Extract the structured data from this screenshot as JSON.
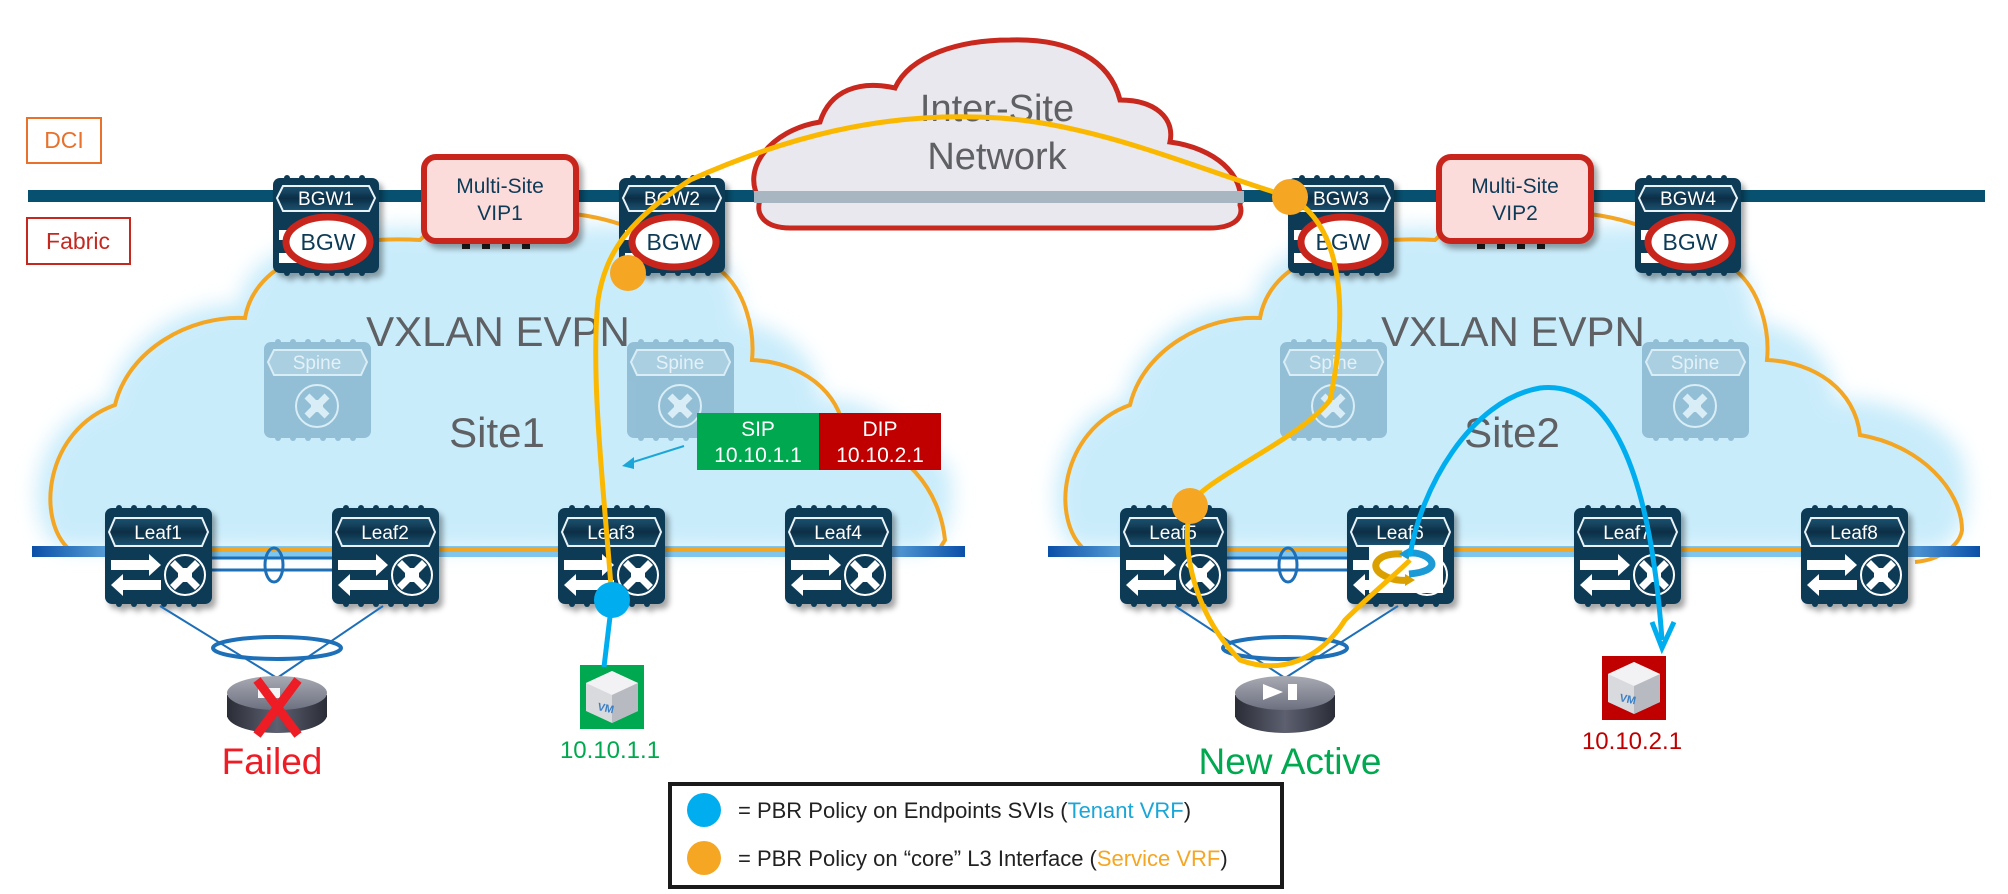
{
  "zones": {
    "dci_label": "DCI",
    "fabric_label": "Fabric"
  },
  "inter_site": {
    "line1": "Inter-Site",
    "line2": "Network"
  },
  "site1": {
    "fabric_name": "VXLAN EVPN",
    "site_name": "Site1",
    "bgws": [
      {
        "label": "BGW1",
        "badge": "BGW"
      },
      {
        "label": "BGW2",
        "badge": "BGW"
      }
    ],
    "vip": {
      "line1": "Multi-Site",
      "line2": "VIP1"
    },
    "spines": [
      {
        "label": "Spine"
      },
      {
        "label": "Spine"
      }
    ],
    "leaves": [
      {
        "label": "Leaf1"
      },
      {
        "label": "Leaf2"
      },
      {
        "label": "Leaf3"
      },
      {
        "label": "Leaf4"
      }
    ],
    "service_node_status": "Failed",
    "endpoint": {
      "ip": "10.10.1.1",
      "icon": "vm-icon",
      "color": "#00a94f"
    }
  },
  "site2": {
    "fabric_name": "VXLAN EVPN",
    "site_name": "Site2",
    "bgws": [
      {
        "label": "BGW3",
        "badge": "BGW"
      },
      {
        "label": "BGW4",
        "badge": "BGW"
      }
    ],
    "vip": {
      "line1": "Multi-Site",
      "line2": "VIP2"
    },
    "spines": [
      {
        "label": "Spine"
      },
      {
        "label": "Spine"
      }
    ],
    "leaves": [
      {
        "label": "Leaf5"
      },
      {
        "label": "Leaf6"
      },
      {
        "label": "Leaf7"
      },
      {
        "label": "Leaf8"
      }
    ],
    "service_node_status": "New Active",
    "endpoint": {
      "ip": "10.10.2.1",
      "icon": "vm-icon",
      "color": "#c00000"
    }
  },
  "packet_header": {
    "sip_label": "SIP",
    "sip_value": "10.10.1.1",
    "dip_label": "DIP",
    "dip_value": "10.10.2.1",
    "sip_color": "#00a94f",
    "dip_color": "#c00000"
  },
  "legend": {
    "items": [
      {
        "marker_color": "#00aeef",
        "prefix": "= PBR Policy on Endpoints SVIs (",
        "highlight": "Tenant VRF",
        "suffix": ")",
        "highlight_color": "#1ba6d8"
      },
      {
        "marker_color": "#f5a623",
        "prefix": "= PBR Policy on “core” L3 Interface (",
        "highlight": "Service VRF",
        "suffix": ")",
        "highlight_color": "#f5a623"
      }
    ]
  },
  "colors": {
    "dci_line": "#07506f",
    "device_fill": "#0d3b57",
    "fabric_cloud": "#c9ecfb",
    "fabric_outline": "#f3a623",
    "service_path": "#fbb800",
    "tenant_path": "#00aeef",
    "vip_fill": "#fcdcdb",
    "vip_border": "#c8281e",
    "failed": "#ee1c25",
    "new_active": "#00a94f"
  }
}
